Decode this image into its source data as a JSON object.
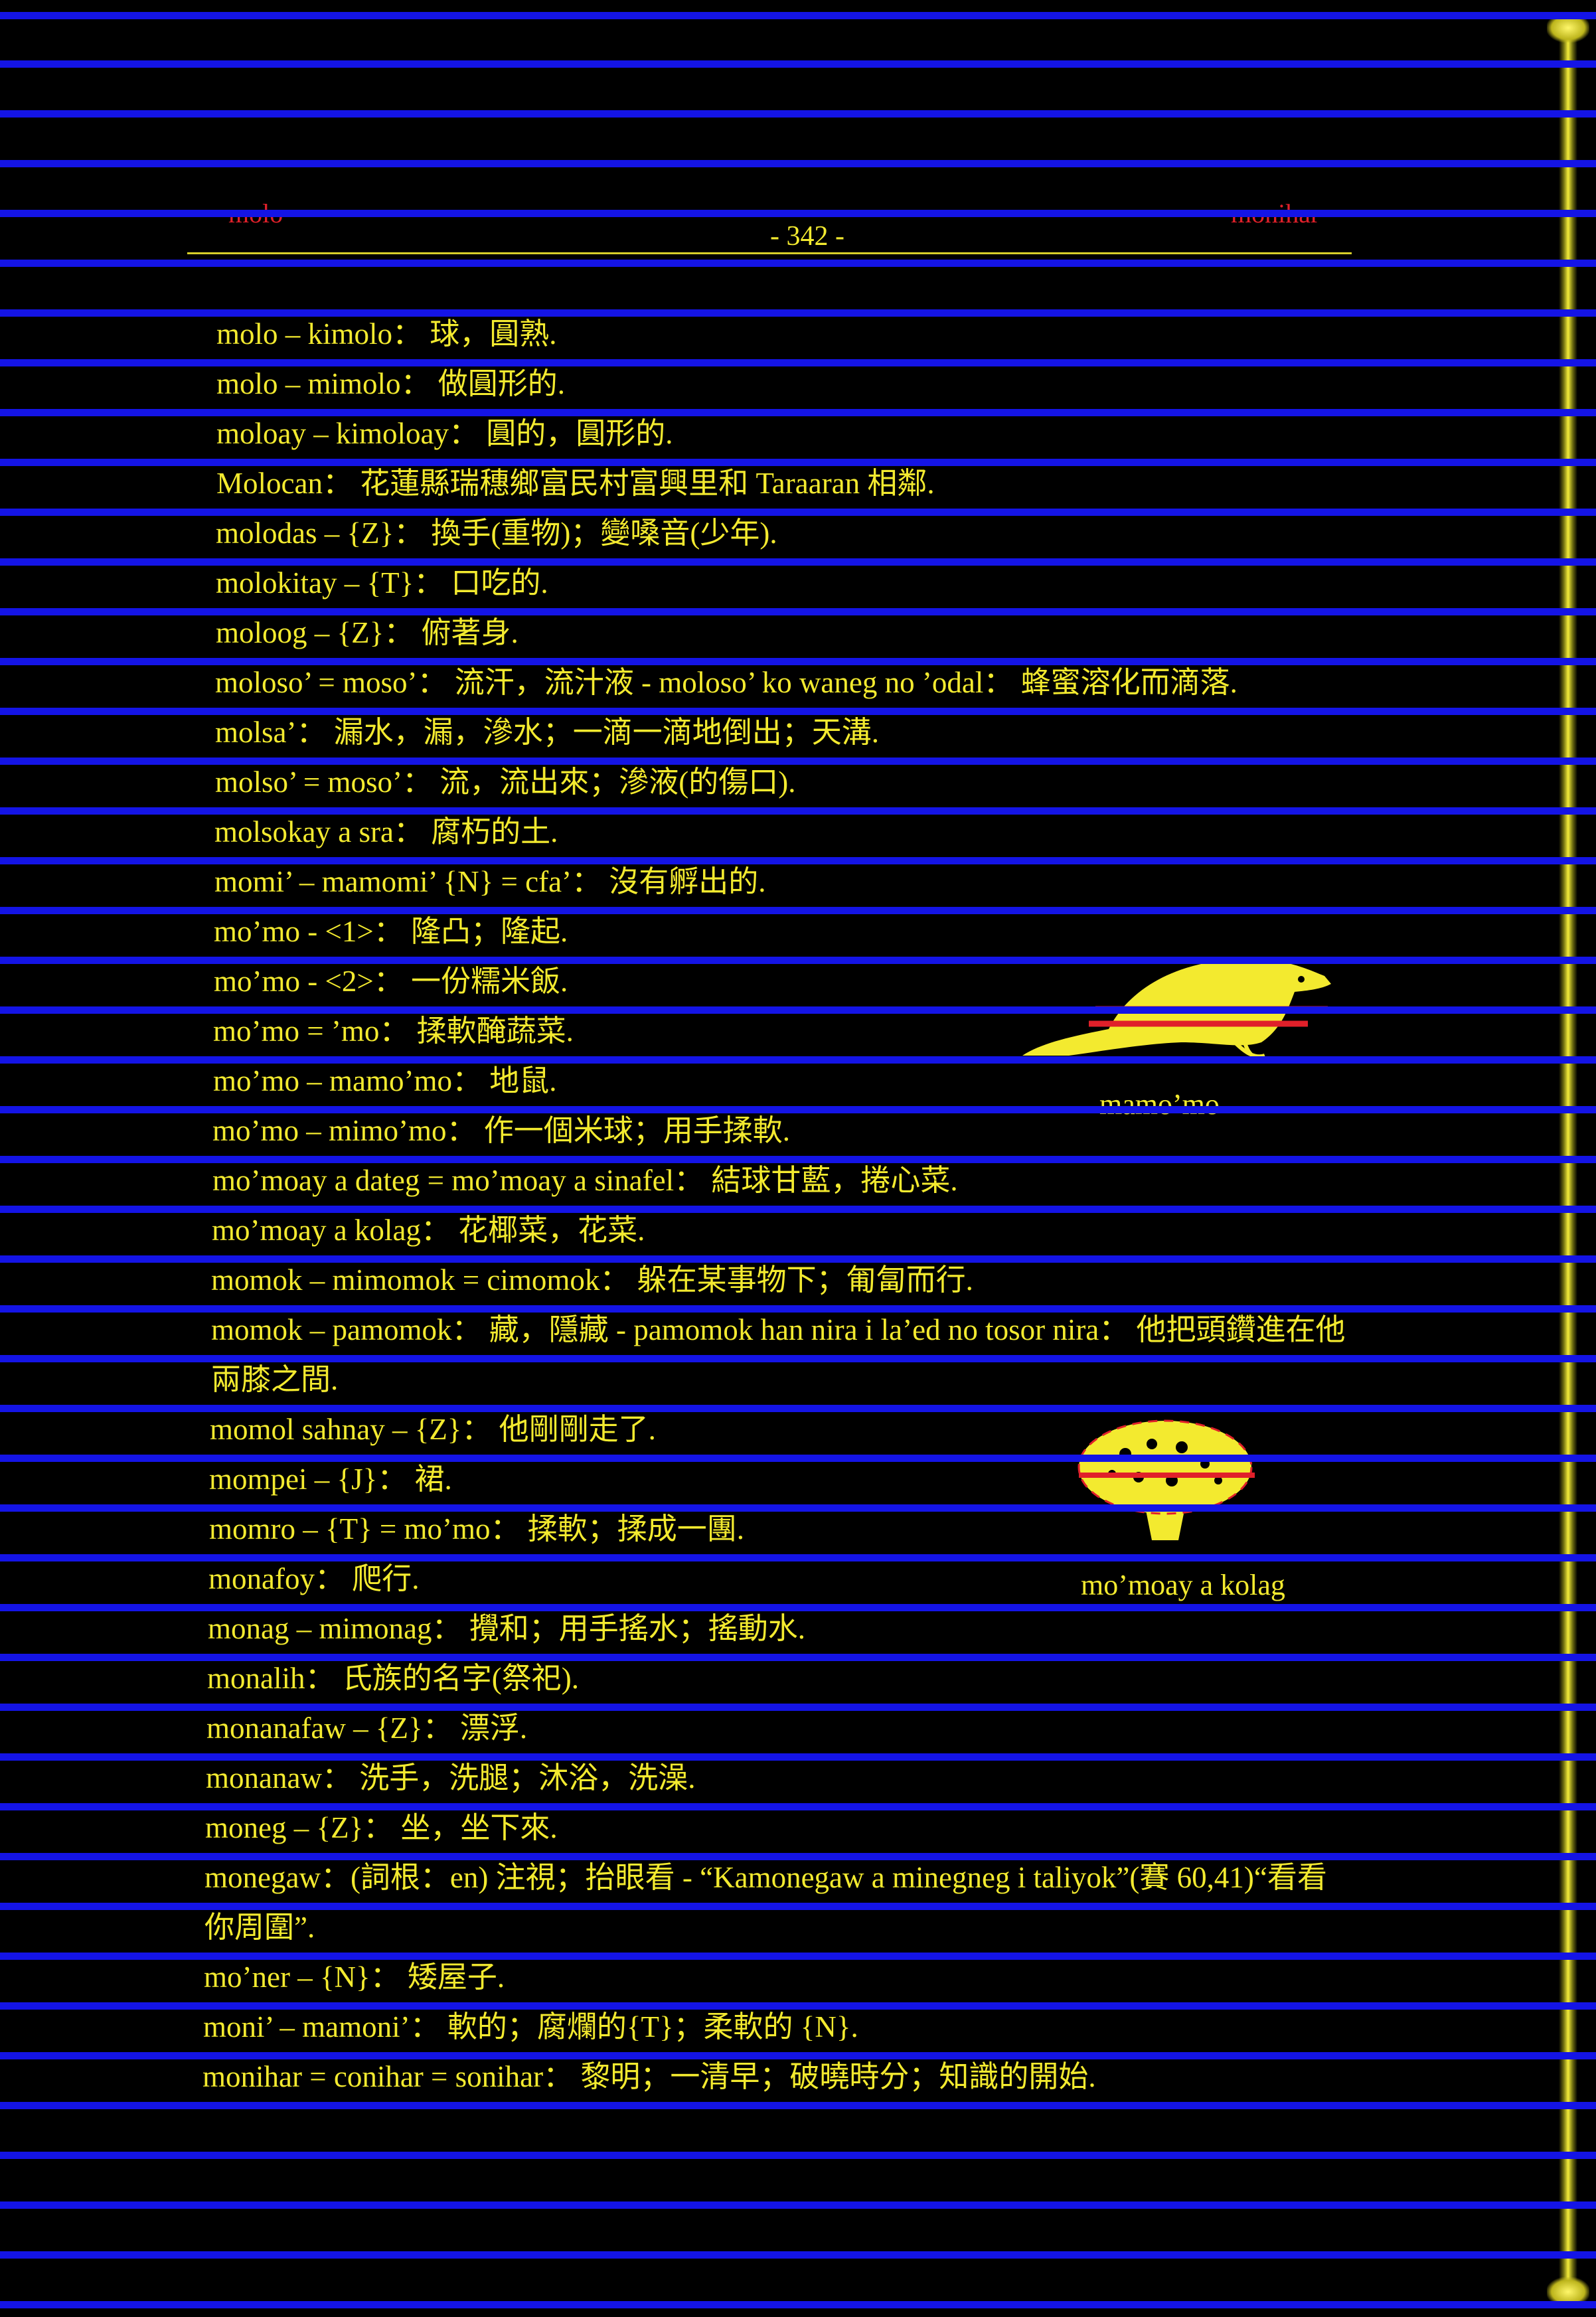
{
  "header": {
    "left_guide": "molo",
    "page_number": "- 342 -",
    "right_guide": "monihar"
  },
  "entries": [
    "molo – kimolo： 球，圓熟.",
    "molo – mimolo： 做圓形的.",
    "moloay – kimoloay： 圓的，圓形的.",
    "Molocan： 花蓮縣瑞穗鄉富民村富興里和 Taraaran 相鄰.",
    "molodas – {Z}： 換手(重物)；變嗓音(少年).",
    "molokitay – {T}： 口吃的.",
    "moloog – {Z}： 俯著身.",
    "moloso’ = moso’： 流汗，流汁液 - moloso’ ko waneg no ’odal： 蜂蜜溶化而滴落.",
    "molsa’： 漏水，漏，滲水；一滴一滴地倒出；天溝.",
    "molso’ = moso’： 流，流出來；滲液(的傷口).",
    "molsokay a sra： 腐朽的土.",
    "momi’ – mamomi’ {N} = cfa’： 沒有孵出的.",
    "mo’mo - <1>： 隆凸；隆起.",
    "mo’mo - <2>： 一份糯米飯.",
    "mo’mo = ’mo： 揉軟醃蔬菜.",
    "mo’mo – mamo’mo： 地鼠.",
    "mo’mo – mimo’mo： 作一個米球；用手揉軟.",
    "mo’moay a dateg = mo’moay a sinafel： 結球甘藍，捲心菜.",
    "mo’moay a kolag： 花椰菜，花菜.",
    "momok – mimomok = cimomok： 躲在某事物下；匍匐而行.",
    "momok – pamomok： 藏，隱藏 - pamomok han nira i la’ed no tosor nira： 他把頭鑽進在他兩膝之間.",
    "momol sahnay – {Z}： 他剛剛走了.",
    "mompei – {J}： 裙.",
    "momro – {T} = mo’mo： 揉軟；揉成一團.",
    "monafoy： 爬行.",
    "monag – mimonag： 攪和；用手搖水；搖動水.",
    "monalih： 氏族的名字(祭祀).",
    "monanafaw – {Z}： 漂浮.",
    "monanaw： 洗手，洗腿；沐浴，洗澡.",
    "moneg – {Z}： 坐，坐下來.",
    "monegaw：(詞根：en) 注視；抬眼看 - “Kamonegaw a minegneg i taliyok”(賽 60,41)“看看你周圍”.",
    "mo’ner – {N}： 矮屋子.",
    "moni’ – mamoni’： 軟的；腐爛的{T}；柔軟的 {N}.",
    "monihar = conihar = sonihar： 黎明；一清早；破曉時分；知識的開始."
  ],
  "illustrations": {
    "mole_caption": "mamo’mo",
    "cauliflower_caption": "mo’moay a kolag"
  },
  "colors": {
    "background": "#000000",
    "text": "#f3ea2f",
    "guide_words": "#e0202a",
    "rules": "#1414e6"
  }
}
